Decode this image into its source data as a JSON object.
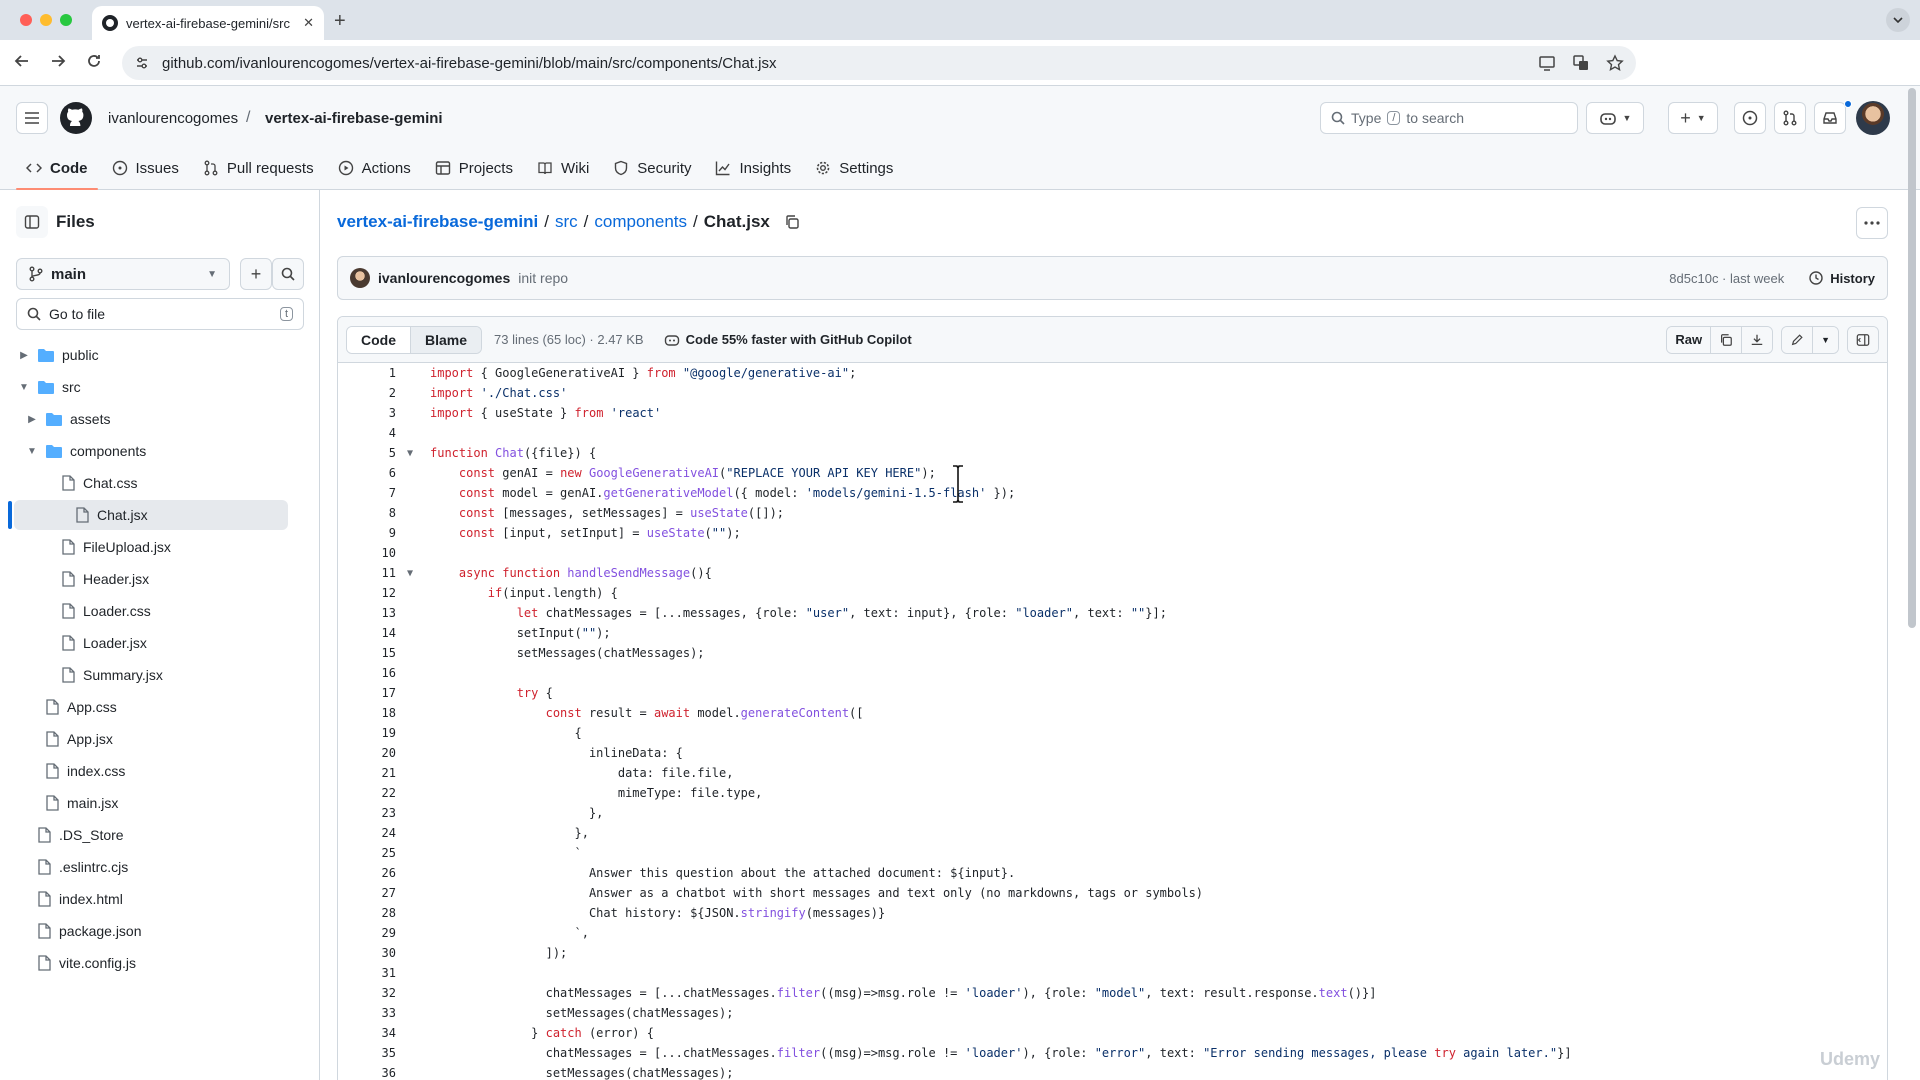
{
  "browser": {
    "tab_title": "vertex-ai-firebase-gemini/src",
    "url": "github.com/ivanlourencogomes/vertex-ai-firebase-gemini/blob/main/src/components/Chat.jsx",
    "colors": {
      "red": "#ff5f57",
      "yellow": "#febc2e",
      "green": "#28c840"
    }
  },
  "header": {
    "owner": "ivanlourencogomes",
    "repo": "vertex-ai-firebase-gemini",
    "search_prefix": "Type",
    "search_key": "/",
    "search_suffix": "to search"
  },
  "repo_nav": [
    {
      "label": "Code",
      "icon": "code-icon"
    },
    {
      "label": "Issues",
      "icon": "issue-icon"
    },
    {
      "label": "Pull requests",
      "icon": "pull-request-icon"
    },
    {
      "label": "Actions",
      "icon": "play-icon"
    },
    {
      "label": "Projects",
      "icon": "table-icon"
    },
    {
      "label": "Wiki",
      "icon": "book-icon"
    },
    {
      "label": "Security",
      "icon": "shield-icon"
    },
    {
      "label": "Insights",
      "icon": "graph-icon"
    },
    {
      "label": "Settings",
      "icon": "gear-icon"
    }
  ],
  "sidebar": {
    "title": "Files",
    "branch": "main",
    "goto_placeholder": "Go to file",
    "goto_key": "t",
    "tree": [
      {
        "label": "public",
        "type": "folder",
        "expanded": false
      },
      {
        "label": "src",
        "type": "folder",
        "expanded": true
      },
      {
        "label": "assets",
        "type": "folder",
        "expanded": false
      },
      {
        "label": "components",
        "type": "folder",
        "expanded": true
      },
      {
        "label": "Chat.css",
        "type": "file"
      },
      {
        "label": "Chat.jsx",
        "type": "file",
        "selected": true
      },
      {
        "label": "FileUpload.jsx",
        "type": "file"
      },
      {
        "label": "Header.jsx",
        "type": "file"
      },
      {
        "label": "Loader.css",
        "type": "file"
      },
      {
        "label": "Loader.jsx",
        "type": "file"
      },
      {
        "label": "Summary.jsx",
        "type": "file"
      },
      {
        "label": "App.css",
        "type": "file"
      },
      {
        "label": "App.jsx",
        "type": "file"
      },
      {
        "label": "index.css",
        "type": "file"
      },
      {
        "label": "main.jsx",
        "type": "file"
      },
      {
        "label": ".DS_Store",
        "type": "file"
      },
      {
        "label": ".eslintrc.cjs",
        "type": "file"
      },
      {
        "label": "index.html",
        "type": "file"
      },
      {
        "label": "package.json",
        "type": "file"
      },
      {
        "label": "vite.config.js",
        "type": "file"
      }
    ]
  },
  "breadcrumb": {
    "repo": "vertex-ai-firebase-gemini",
    "sep": "/",
    "src": "src",
    "components": "components",
    "file": "Chat.jsx"
  },
  "commit": {
    "user": "ivanlourencogomes",
    "message": "init repo",
    "meta": "8d5c10c · last week",
    "history_label": "History"
  },
  "file_toolbar": {
    "code_label": "Code",
    "blame_label": "Blame",
    "info": "73 lines (65 loc) · 2.47 KB",
    "copilot": "Code 55% faster with GitHub Copilot",
    "raw_label": "Raw"
  },
  "code_lines": [
    "import { GoogleGenerativeAI } from \"@google/generative-ai\";",
    "import './Chat.css'",
    "import { useState } from 'react'",
    "",
    "function Chat({file}) {",
    "    const genAI = new GoogleGenerativeAI(\"REPLACE YOUR API KEY HERE\");",
    "    const model = genAI.getGenerativeModel({ model: 'models/gemini-1.5-flash' });",
    "    const [messages, setMessages] = useState([]);",
    "    const [input, setInput] = useState(\"\");",
    "",
    "    async function handleSendMessage(){",
    "        if(input.length) {",
    "            let chatMessages = [...messages, {role: \"user\", text: input}, {role: \"loader\", text: \"\"}];",
    "            setInput(\"\");",
    "            setMessages(chatMessages);",
    "",
    "            try {",
    "                const result = await model.generateContent([",
    "                    {",
    "                      inlineData: {",
    "                          data: file.file,",
    "                          mimeType: file.type,",
    "                      },",
    "                    },",
    "                    `",
    "                      Answer this question about the attached document: ${input}.",
    "                      Answer as a chatbot with short messages and text only (no markdowns, tags or symbols)",
    "                      Chat history: ${JSON.stringify(messages)}",
    "                    `,",
    "                ]);",
    "",
    "                chatMessages = [...chatMessages.filter((msg)=>msg.role != 'loader'), {role: \"model\", text: result.response.text()}]",
    "                setMessages(chatMessages);",
    "              } catch (error) {",
    "                chatMessages = [...chatMessages.filter((msg)=>msg.role != 'loader'), {role: \"error\", text: \"Error sending messages, please try again later.\"}]",
    "                setMessages(chatMessages);"
  ],
  "fold_lines": [
    5,
    11
  ],
  "watermark": "Udemy"
}
